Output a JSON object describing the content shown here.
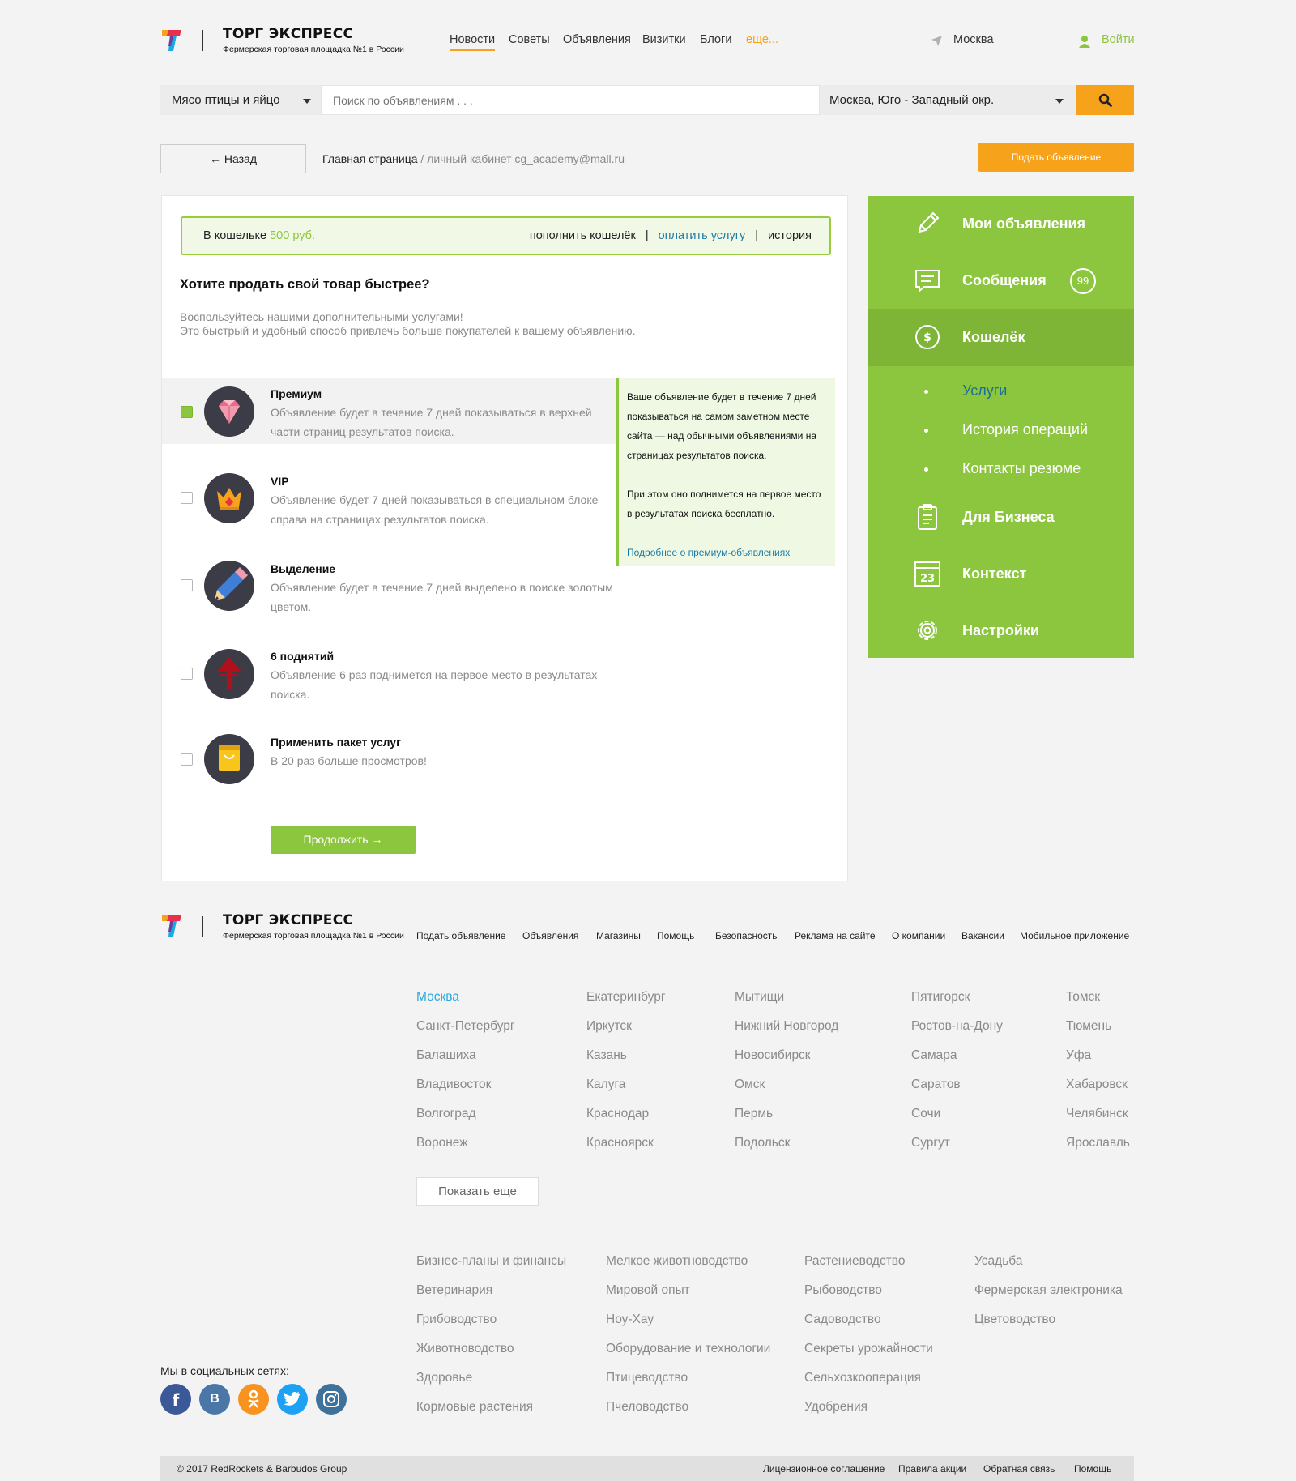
{
  "header": {
    "logo_title": "ТОРГ ЭКСПРЕСС",
    "logo_subtitle": "Фермерская торговая площадка №1 в России",
    "nav": [
      "Новости",
      "Советы",
      "Объявления",
      "Визитки",
      "Блоги"
    ],
    "nav_more": "еще...",
    "city": "Москва",
    "login": "Войти"
  },
  "search": {
    "category": "Мясо птицы и яйцо",
    "placeholder": "Поиск по объявлениям . . .",
    "location": "Москва, Юго - Западный окр."
  },
  "toolbar": {
    "back": "Назад",
    "crumb_home": "Главная страница",
    "crumb_rest": " / личный кабинет cg_academy@mall.ru",
    "post_ad": "Подать объявление"
  },
  "wallet": {
    "label": "В кошельке",
    "amount": "500 руб.",
    "topup": "пополнить кошелёк",
    "pay": "оплатить услугу",
    "history": "история"
  },
  "main": {
    "heading": "Хотите продать свой товар быстрее?",
    "lead1": "Воспользуйтесь нашими дополнительными услугами!",
    "lead2": "Это быстрый и удобный способ привлечь больше покупателей к вашему объявлению.",
    "services": [
      {
        "title": "Премиум",
        "desc": "Объявление будет в течение 7 дней показываться в верхней части страниц результатов поиска.",
        "checked": true,
        "icon": "diamond-icon"
      },
      {
        "title": "VIP",
        "desc": "Объявление будет 7 дней показываться в специальном блоке справа на страницах результатов поиска.",
        "checked": false,
        "icon": "crown-icon"
      },
      {
        "title": "Выделение",
        "desc": "Объявление будет в течение 7 дней выделено в поиске золотым цветом.",
        "checked": false,
        "icon": "pencil-icon"
      },
      {
        "title": "6 поднятий",
        "desc": "Объявление 6 раз поднимется на первое место в результатах поиска.",
        "checked": false,
        "icon": "arrow-up-icon"
      },
      {
        "title": "Применить пакет услуг",
        "desc": "В 20 раз больше просмотров!",
        "checked": false,
        "icon": "shopping-bag-icon"
      }
    ],
    "tip_p1": "Ваше объявление будет в течение 7 дней показываться на самом заметном месте сайта — над обычными объявлениями на страницах результатов поиска.",
    "tip_p2": "При этом оно поднимется на первое место в результатах поиска бесплатно.",
    "tip_link": "Подробнее о премиум-объявлениях",
    "continue": "Продолжить"
  },
  "sidebar": {
    "items": [
      {
        "label": "Мои объявления",
        "icon": "pencil-icon"
      },
      {
        "label": "Сообщения",
        "icon": "chat-icon",
        "badge": "99"
      },
      {
        "label": "Кошелёк",
        "icon": "dollar-icon"
      }
    ],
    "sub": [
      "Услуги",
      "История операций",
      "Контакты резюме"
    ],
    "items2": [
      {
        "label": "Для Бизнеса",
        "icon": "clipboard-icon"
      },
      {
        "label": "Контекст",
        "icon": "calendar-icon",
        "day": "23"
      },
      {
        "label": "Настройки",
        "icon": "gear-icon"
      }
    ]
  },
  "footer": {
    "links": [
      "Подать объявление",
      "Объявления",
      "Магазины",
      "Помощь",
      "Безопасность",
      "Реклама на сайте",
      "О компании",
      "Вакансии",
      "Мобильное приложение"
    ],
    "cities": [
      [
        "Москва",
        "Санкт-Петербург",
        "Балашиха",
        "Владивосток",
        "Волгоград",
        "Воронеж"
      ],
      [
        "Екатеринбург",
        "Иркутск",
        "Казань",
        "Калуга",
        "Краснодар",
        "Красноярск"
      ],
      [
        "Мытищи",
        "Нижний Новгород",
        "Новосибирск",
        "Омск",
        "Пермь",
        "Подольск"
      ],
      [
        "Пятигорск",
        "Ростов-на-Дону",
        "Самара",
        "Саратов",
        "Сочи",
        "Сургут"
      ],
      [
        "Томск",
        "Тюмень",
        "Уфа",
        "Хабаровск",
        "Челябинск",
        "Ярославль"
      ]
    ],
    "show_more": "Показать еще",
    "categories": [
      [
        "Бизнес-планы и финансы",
        "Ветеринария",
        "Грибоводство",
        "Животноводство",
        "Здоровье",
        "Кормовые растения"
      ],
      [
        "Мелкое животноводство",
        "Мировой опыт",
        "Ноу-Хау",
        "Оборудование и технологии",
        "Птицеводство",
        "Пчеловодство"
      ],
      [
        "Растениеводство",
        "Рыбоводство",
        "Садоводство",
        "Секреты урожайности",
        "Сельхозкооперация",
        "Удобрения"
      ],
      [
        "Усадьба",
        "Фермерская электроника",
        "Цветоводство"
      ]
    ],
    "social_title": "Мы в социальных сетях:",
    "social": [
      "facebook-icon",
      "vk-icon",
      "odnoklassniki-icon",
      "twitter-icon",
      "instagram-icon"
    ],
    "copyright": "© 2017 RedRockets & Barbudos Group",
    "bottom_links": [
      "Лицензионное соглашение",
      "Правила акции",
      "Обратная связь",
      "Помощь"
    ],
    "colors": {
      "green": "#8cc63f",
      "orange": "#f7a21b",
      "blue": "#29a8e0"
    }
  }
}
